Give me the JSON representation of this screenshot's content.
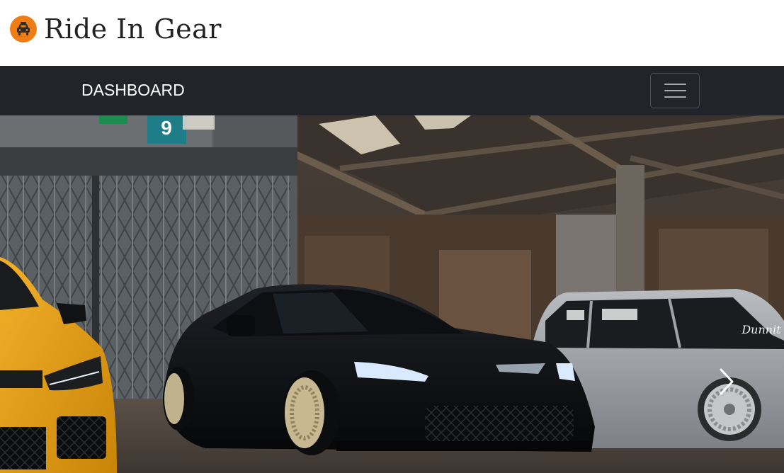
{
  "header": {
    "brand_title": "Ride In Gear",
    "brand_icon": "car-icon",
    "brand_color": "#ef7d16"
  },
  "navbar": {
    "link_label": "DASHBOARD",
    "toggler_icon": "hamburger-menu-icon",
    "background": "#212529"
  },
  "hero": {
    "sign_number": "9",
    "plate_text": "Dunnit",
    "next_icon": "chevron-right-icon"
  }
}
